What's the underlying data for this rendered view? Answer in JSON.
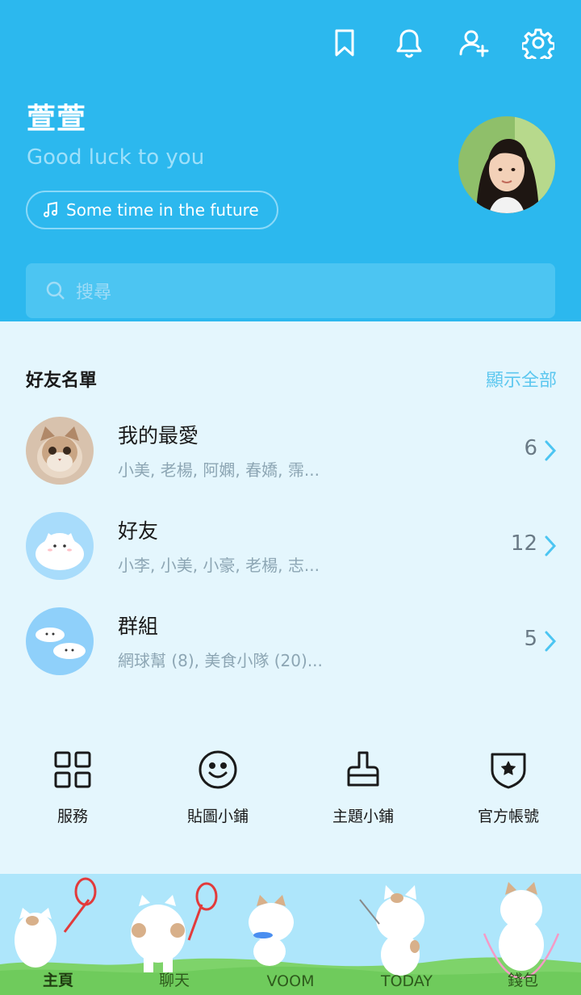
{
  "header": {
    "name": "萱萱",
    "status": "Good luck to you",
    "music": "Some time in the future",
    "icons": [
      "bookmark-icon",
      "bell-icon",
      "add-friend-icon",
      "gear-icon"
    ]
  },
  "search": {
    "placeholder": "搜尋"
  },
  "friends": {
    "title": "好友名單",
    "show_all": "顯示全部",
    "rows": [
      {
        "title": "我的最愛",
        "sub": "小美, 老楊, 阿嫻, 春嬌, 霈...",
        "count": "6"
      },
      {
        "title": "好友",
        "sub": "小李, 小美, 小豪, 老楊, 志...",
        "count": "12"
      },
      {
        "title": "群組",
        "sub": "網球幫 (8), 美食小隊 (20)...",
        "count": "5"
      }
    ]
  },
  "services": [
    {
      "label": "服務",
      "icon": "grid-icon"
    },
    {
      "label": "貼圖小鋪",
      "icon": "smiley-icon"
    },
    {
      "label": "主題小鋪",
      "icon": "brush-icon"
    },
    {
      "label": "官方帳號",
      "icon": "shield-star-icon"
    }
  ],
  "nav": [
    {
      "label": "主頁"
    },
    {
      "label": "聊天"
    },
    {
      "label": "VOOM"
    },
    {
      "label": "TODAY"
    },
    {
      "label": "錢包"
    }
  ],
  "colors": {
    "header": "#2cb8ee",
    "background": "#e4f6fd",
    "accent": "#5cc7ef"
  }
}
